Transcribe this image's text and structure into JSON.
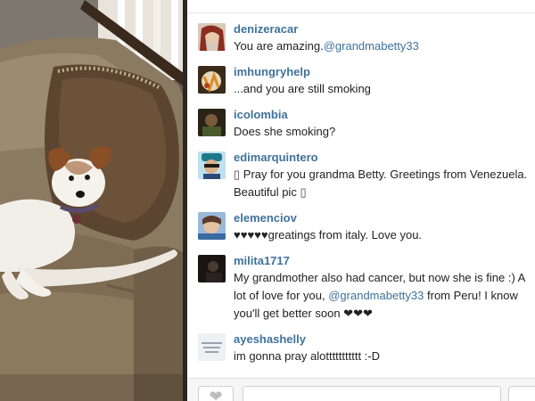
{
  "comments": [
    {
      "username": "denizeracar",
      "text": "You are amazing.",
      "mention": "@grandmabetty33",
      "avatar": "avatar-woman-red-hair"
    },
    {
      "username": "imhungryhelp",
      "text": "...and you are still smoking",
      "avatar": "avatar-food-plate"
    },
    {
      "username": "icolombia",
      "text": "Does she smoking?",
      "avatar": "avatar-dark-portrait"
    },
    {
      "username": "edimarquintero",
      "glyph_before": "▯",
      "text": "Pray for you grandma Betty. Greetings from Venezuela. Beautiful pic",
      "glyph_after": "▯",
      "avatar": "avatar-man-cap-sunglasses"
    },
    {
      "username": "elemenciov",
      "text": "♥♥♥♥♥greatings from italy. Love you.",
      "avatar": "avatar-woman-blue"
    },
    {
      "username": "milita1717",
      "text_before": "My grandmother also had cancer, but now she is fine :) A lot of love for you, ",
      "mention": "@grandmabetty33",
      "text_after": " from Peru! I know you'll get better soon ❤❤❤",
      "avatar": "avatar-dark-silhouette"
    },
    {
      "username": "ayeshashelly",
      "text": "im gonna pray alottttttttttt :-D",
      "avatar": "avatar-text-quote"
    }
  ],
  "colors": {
    "username": "#3f729b",
    "text": "#222222",
    "bottom_bar": "#f6f6f6"
  },
  "icons": {
    "like": "heart-icon"
  }
}
